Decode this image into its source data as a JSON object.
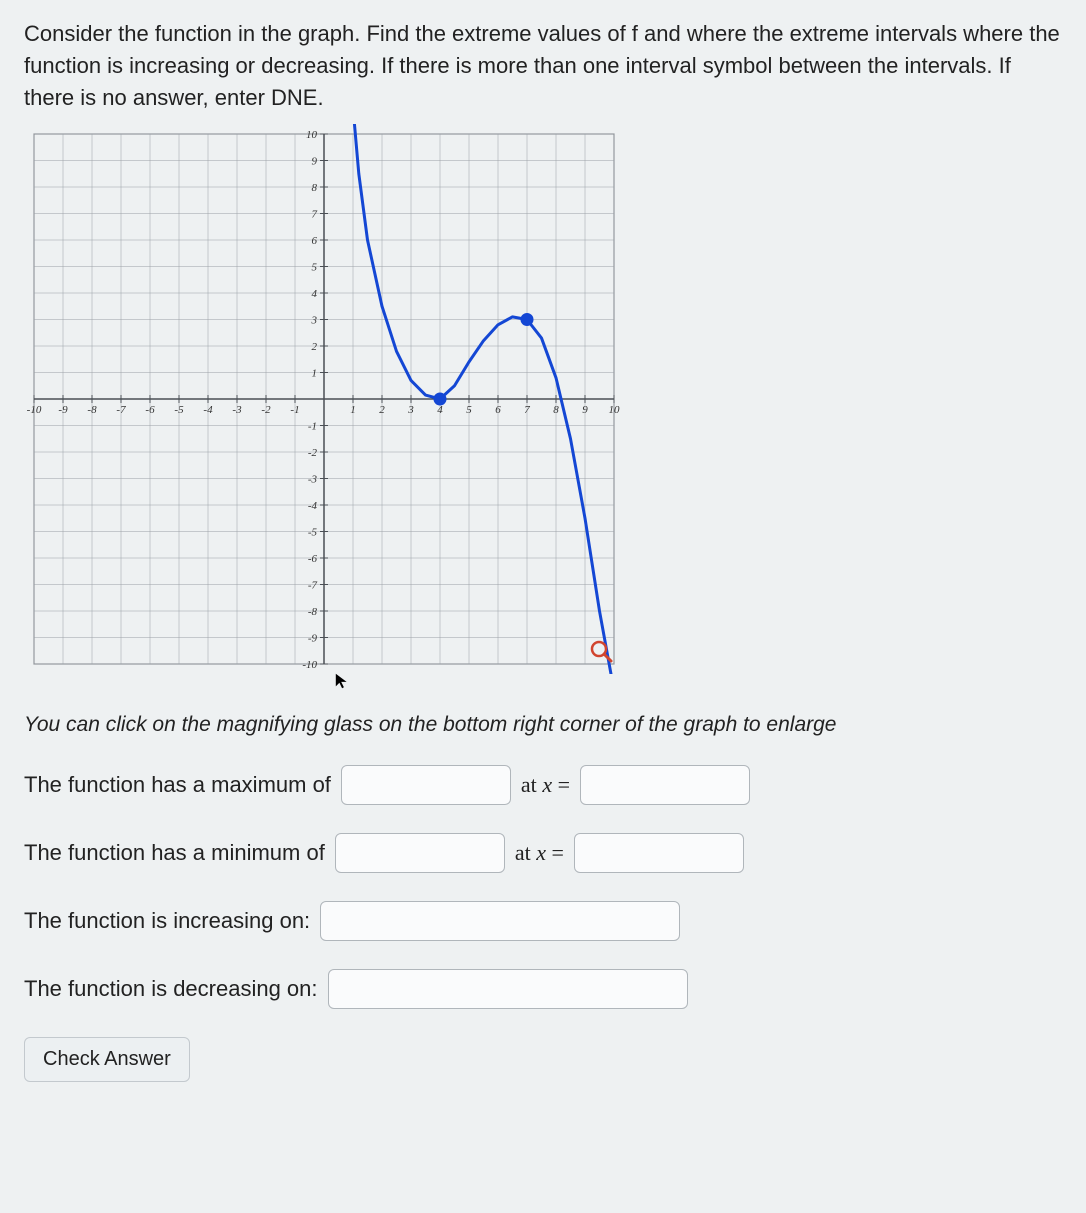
{
  "problem_text": "Consider the function in the graph. Find the extreme values of f and where the extreme intervals where the function is increasing or decreasing. If there is more than one interval symbol between the intervals. If there is no answer, enter DNE.",
  "hint_text": "You can click on the magnifying glass on the bottom right corner of the graph to enlarge",
  "questions": {
    "max_label": "The function has a maximum of",
    "min_label": "The function has a minimum of",
    "inc_label": "The function is increasing on:",
    "dec_label": "The function is decreasing on:",
    "at_x": "at x ="
  },
  "check_answer": "Check Answer",
  "chart_data": {
    "type": "line",
    "title": "",
    "xlabel": "",
    "ylabel": "",
    "xlim": [
      -10,
      10
    ],
    "ylim": [
      -10,
      10
    ],
    "xticks": [
      -10,
      -9,
      -8,
      -7,
      -6,
      -5,
      -4,
      -3,
      -2,
      -1,
      1,
      2,
      3,
      4,
      5,
      6,
      7,
      8,
      9,
      10
    ],
    "yticks": [
      -10,
      -9,
      -8,
      -7,
      -6,
      -5,
      -4,
      -3,
      -2,
      -1,
      1,
      2,
      3,
      4,
      5,
      6,
      7,
      8,
      9,
      10
    ],
    "grid": true,
    "series": [
      {
        "name": "f",
        "color": "#1447d4",
        "points": [
          [
            1.0,
            11.0
          ],
          [
            1.2,
            8.5
          ],
          [
            1.5,
            6.0
          ],
          [
            2.0,
            3.5
          ],
          [
            2.5,
            1.8
          ],
          [
            3.0,
            0.7
          ],
          [
            3.5,
            0.15
          ],
          [
            4.0,
            0.0
          ],
          [
            4.5,
            0.5
          ],
          [
            5.0,
            1.4
          ],
          [
            5.5,
            2.2
          ],
          [
            6.0,
            2.8
          ],
          [
            6.5,
            3.1
          ],
          [
            7.0,
            3.0
          ],
          [
            7.5,
            2.3
          ],
          [
            8.0,
            0.8
          ],
          [
            8.5,
            -1.5
          ],
          [
            9.0,
            -4.5
          ],
          [
            9.5,
            -8.0
          ],
          [
            10.0,
            -11.0
          ]
        ],
        "markers": [
          {
            "x": 4,
            "y": 0
          },
          {
            "x": 7,
            "y": 3
          }
        ]
      }
    ]
  }
}
